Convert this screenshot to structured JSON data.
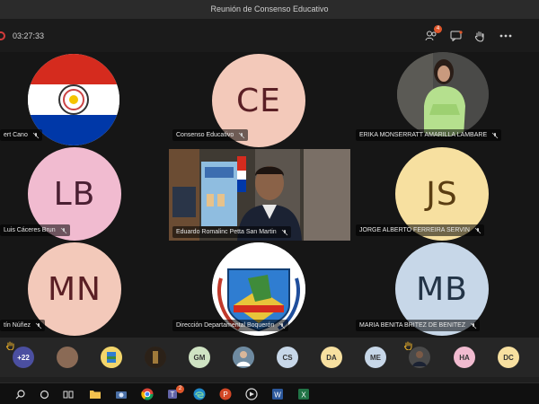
{
  "window": {
    "title": "Reunión de Consenso Educativo"
  },
  "toolbar": {
    "timer": "03:27:33",
    "participants_badge": "4",
    "buttons": [
      "participants-icon",
      "chat-icon",
      "raise-hand-icon",
      "more-icon"
    ]
  },
  "tiles": [
    {
      "name": "ert Cano",
      "avatar_type": "image",
      "avatar": "paraguay-flag-seal"
    },
    {
      "name": "Consenso Educativo",
      "avatar_type": "initials",
      "initials": "CE",
      "color": "#f3c9ba"
    },
    {
      "name": "ERIKA MONSERRATT AMARILLA LAMBARE",
      "avatar_type": "image",
      "avatar": "photo-woman"
    },
    {
      "name": "Luis Cáceres Brun",
      "avatar_type": "initials",
      "initials": "LB",
      "color": "#f1bbd0"
    },
    {
      "name": "Eduardo Romalinc Petta San Martin",
      "avatar_type": "video",
      "avatar": "video-feed"
    },
    {
      "name": "JORGE ALBERTO FERREIRA SERVIN",
      "avatar_type": "initials",
      "initials": "JS",
      "color": "#f7e0a0"
    },
    {
      "name": "tín Núñez",
      "avatar_type": "initials",
      "initials": "MN",
      "color": "#f3c9ba"
    },
    {
      "name": "Dirección Departamental Boquerón",
      "avatar_type": "image",
      "avatar": "boqueron-emblem"
    },
    {
      "name": "MARIA BENITA BRITEZ DE BENITEZ",
      "avatar_type": "initials",
      "initials": "MB",
      "color": "#c7d7e8"
    }
  ],
  "participants_bar": {
    "overflow_label": "+22",
    "items": [
      {
        "type": "photo",
        "icon": "participant-photo-icon"
      },
      {
        "type": "photo",
        "icon": "participant-emblem-icon"
      },
      {
        "type": "photo",
        "icon": "participant-shield-icon"
      },
      {
        "type": "initials",
        "text": "GM",
        "color": "#cfe3c3"
      },
      {
        "type": "photo",
        "icon": "participant-photo-icon"
      },
      {
        "type": "initials",
        "text": "CS",
        "color": "#c7d7e8"
      },
      {
        "type": "initials",
        "text": "DA",
        "color": "#f7e0a0"
      },
      {
        "type": "initials",
        "text": "ME",
        "color": "#c7d7e8"
      },
      {
        "type": "photo",
        "icon": "participant-photo-icon"
      },
      {
        "type": "initials",
        "text": "HA",
        "color": "#f1bbd0"
      },
      {
        "type": "initials",
        "text": "DC",
        "color": "#f7e0a0"
      }
    ]
  },
  "taskbar": {
    "icons": [
      "search-icon",
      "cortana-icon",
      "task-view-icon",
      "file-explorer-icon",
      "camera-icon",
      "chrome-icon",
      "teams-icon",
      "edge-icon",
      "powerpoint-icon",
      "media-icon",
      "word-icon",
      "excel-icon"
    ],
    "teams_badge": "2"
  },
  "colors": {
    "accent_teams": "#6264a7",
    "badge": "#e0572b",
    "recording": "#d43b3b"
  }
}
